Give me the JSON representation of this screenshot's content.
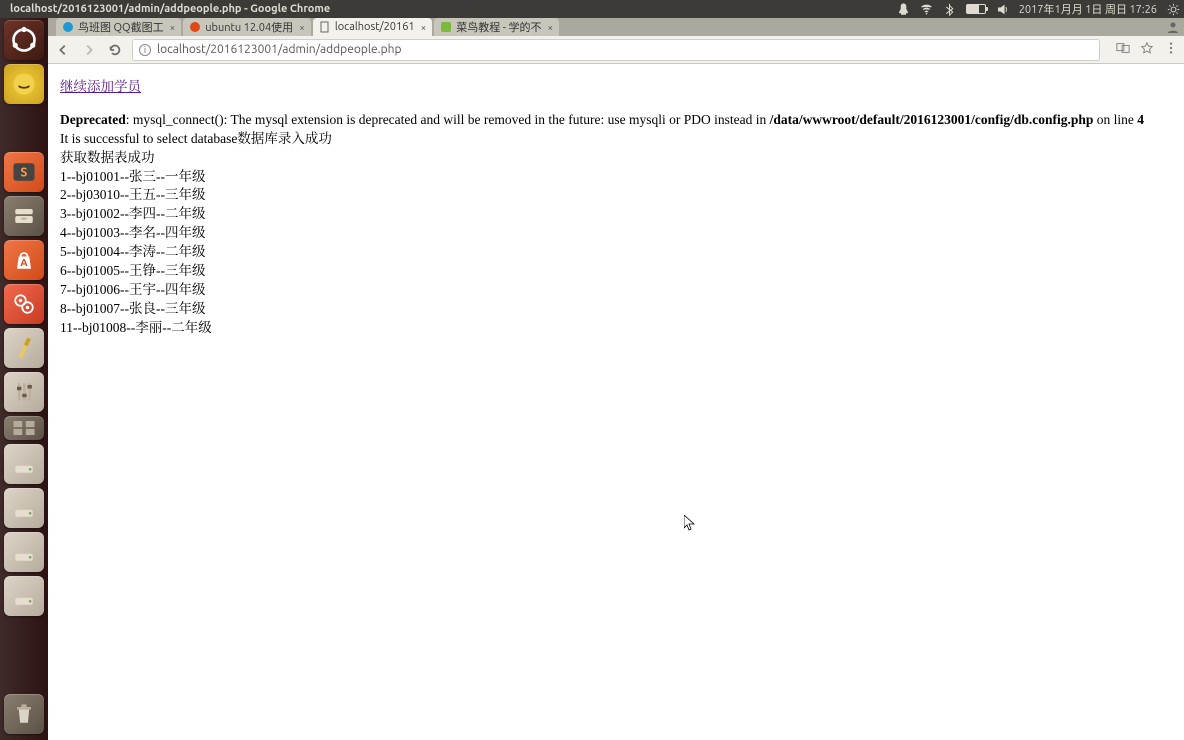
{
  "panel": {
    "window_title": "localhost/2016123001/admin/addpeople.php - Google Chrome",
    "clock": "2017年1月月 1日 周日 17:26"
  },
  "launcher": {
    "items": [
      {
        "name": "ubuntu-dash",
        "icon": "ubuntu"
      },
      {
        "name": "app-yellow",
        "icon": "yellow-disk"
      },
      {
        "name": "chrome",
        "icon": "chrome"
      },
      {
        "name": "sublime",
        "icon": "sublime"
      },
      {
        "name": "files",
        "icon": "files"
      },
      {
        "name": "software-center",
        "icon": "software-bag"
      },
      {
        "name": "settings",
        "icon": "gears"
      },
      {
        "name": "brush",
        "icon": "brush"
      },
      {
        "name": "sound-settings",
        "icon": "sliders"
      },
      {
        "name": "workspace-switcher",
        "icon": "workspaces"
      },
      {
        "name": "drive-1",
        "icon": "drive"
      },
      {
        "name": "drive-2",
        "icon": "drive"
      },
      {
        "name": "drive-3",
        "icon": "drive"
      },
      {
        "name": "drive-4",
        "icon": "drive"
      }
    ],
    "trash": {
      "name": "trash",
      "icon": "trash"
    }
  },
  "chrome": {
    "tabs": [
      {
        "label": "鸟班图 QQ截图工",
        "favicon": "qq"
      },
      {
        "label": "ubuntu 12.04使用",
        "favicon": "ubuntu-fav"
      },
      {
        "label": "localhost/20161",
        "favicon": "doc",
        "active": true
      },
      {
        "label": "菜鸟教程 - 学的不",
        "favicon": "runoob"
      }
    ],
    "url": "localhost/2016123001/admin/addpeople.php",
    "star_title": "Bookmark this page"
  },
  "page": {
    "add_link": "继续添加学员",
    "deprecated_label": "Deprecated",
    "deprecated_msg": ": mysql_connect(): The mysql extension is deprecated and will be removed in the future: use mysqli or PDO instead in ",
    "deprecated_path": "/data/wwwroot/default/2016123001/config/db.config.php",
    "deprecated_online": " on line ",
    "deprecated_linenum": "4",
    "db_select_ok": "It is successful to select database数据库录入成功",
    "table_ok": "获取数据表成功",
    "records": [
      "1--bj01001--张三--一年级",
      "2--bj03010--王五--三年级",
      "3--bj01002--李四--二年级",
      "4--bj01003--李名--四年级",
      "5--bj01004--李涛--二年级",
      "6--bj01005--王铮--三年级",
      "7--bj01006--王宇--四年级",
      "8--bj01007--张良--三年级",
      "11--bj01008--李丽--二年级"
    ]
  }
}
